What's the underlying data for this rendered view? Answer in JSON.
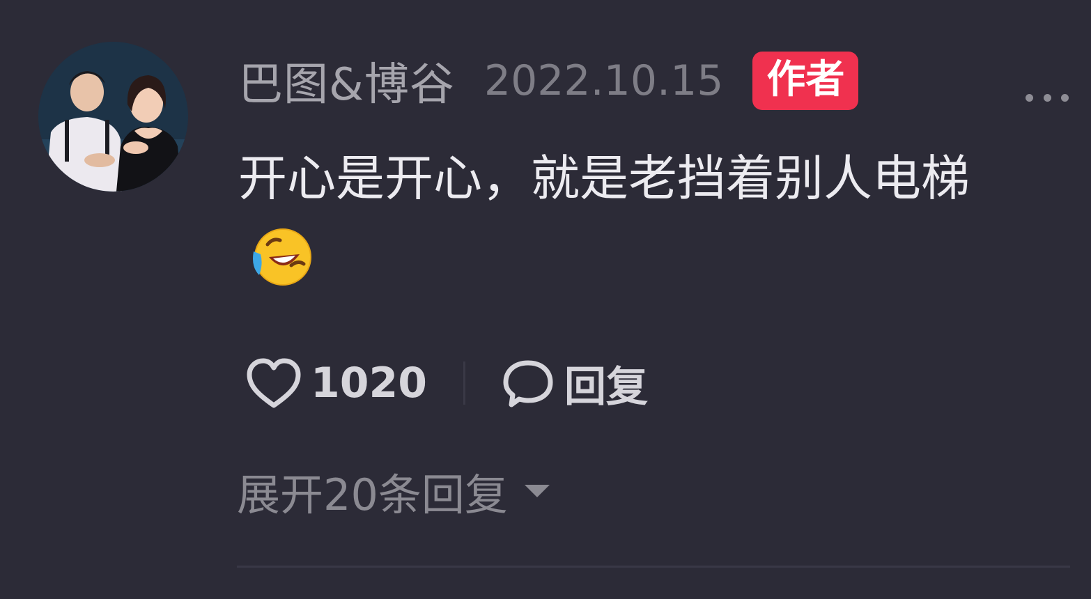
{
  "comment": {
    "username": "巴图&博谷",
    "date": "2022.10.15",
    "author_badge": "作者",
    "text": "开心是开心，就是老挡着别人电梯",
    "emoji": "rolling-on-floor-laughing",
    "like_count": "1020",
    "reply_label": "回复",
    "expand_replies_label": "展开20条回复"
  },
  "colors": {
    "background": "#2c2b37",
    "badge": "#f0314f",
    "username": "#a6a5ad",
    "text": "#ecebf0",
    "muted": "#8b8a92"
  }
}
